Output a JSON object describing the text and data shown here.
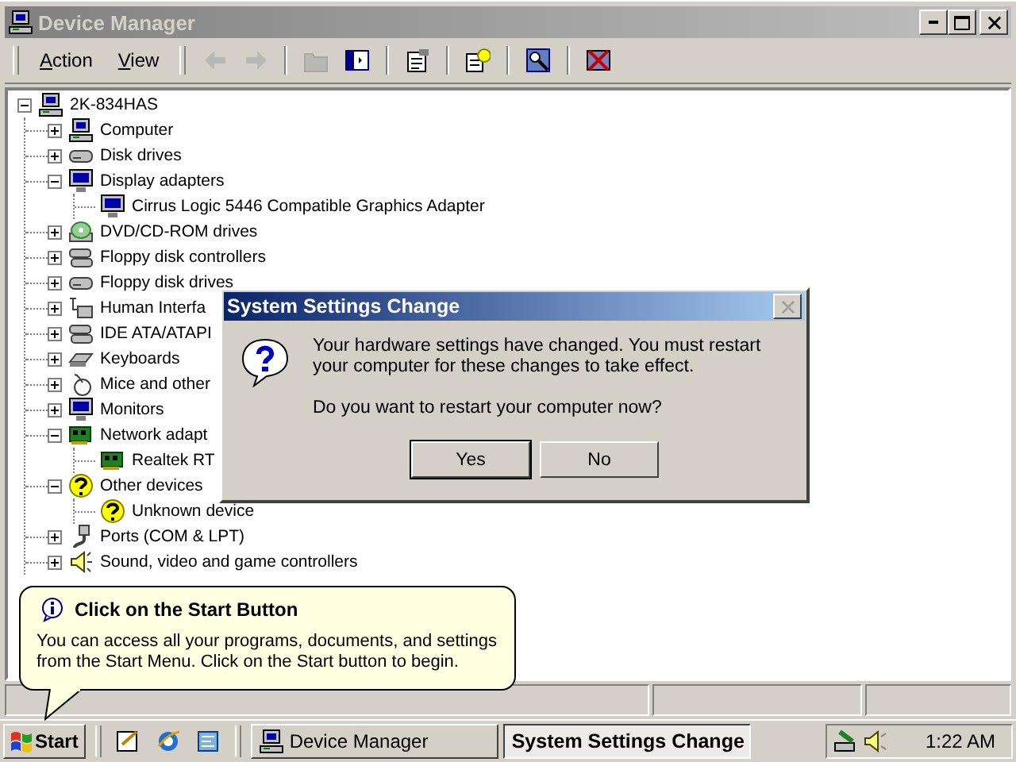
{
  "window": {
    "title": "Device Manager",
    "active": false,
    "menu": [
      {
        "label": "Action"
      },
      {
        "label": "View"
      }
    ],
    "toolbar": [
      {
        "kind": "back",
        "disabled": true
      },
      {
        "kind": "forward",
        "disabled": true
      },
      {
        "kind": "up",
        "disabled": true
      },
      {
        "kind": "tree",
        "disabled": false
      },
      {
        "kind": "properties",
        "disabled": false
      },
      {
        "kind": "help",
        "disabled": false
      },
      {
        "kind": "scan",
        "disabled": false
      },
      {
        "kind": "uninstall",
        "disabled": false
      }
    ]
  },
  "tree": {
    "label": "2K-834HAS",
    "kind": "computer",
    "expanded": true,
    "children": [
      {
        "label": "Computer",
        "kind": "computer",
        "expanded": false
      },
      {
        "label": "Disk drives",
        "kind": "disk",
        "expanded": false
      },
      {
        "label": "Display adapters",
        "kind": "monitor",
        "expanded": true,
        "children": [
          {
            "label": "Cirrus Logic 5446 Compatible Graphics Adapter",
            "kind": "monitor"
          }
        ]
      },
      {
        "label": "DVD/CD-ROM drives",
        "kind": "cdrom",
        "expanded": false
      },
      {
        "label": "Floppy disk controllers",
        "kind": "ide",
        "expanded": false
      },
      {
        "label": "Floppy disk drives",
        "kind": "disk",
        "expanded": false
      },
      {
        "label": "Human Interfa",
        "kind": "hid",
        "expanded": false
      },
      {
        "label": "IDE ATA/ATAPI",
        "kind": "ide",
        "expanded": false
      },
      {
        "label": "Keyboards",
        "kind": "keyboard",
        "expanded": false
      },
      {
        "label": "Mice and other",
        "kind": "mouse",
        "expanded": false
      },
      {
        "label": "Monitors",
        "kind": "monitor",
        "expanded": false
      },
      {
        "label": "Network adapt",
        "kind": "network",
        "expanded": true,
        "children": [
          {
            "label": "Realtek RT",
            "kind": "network"
          }
        ]
      },
      {
        "label": "Other devices",
        "kind": "question",
        "expanded": true,
        "children": [
          {
            "label": "Unknown device",
            "kind": "question"
          }
        ]
      },
      {
        "label": "Ports (COM & LPT)",
        "kind": "port",
        "expanded": false
      },
      {
        "label": "Sound, video and game controllers",
        "kind": "sound",
        "expanded": false
      }
    ]
  },
  "dialog": {
    "title": "System Settings Change",
    "close_disabled": true,
    "message": "Your hardware settings have changed. You must restart your computer for these changes to take effect.",
    "question": "Do you want to restart your computer now?",
    "buttons": [
      {
        "label": "Yes",
        "default": true
      },
      {
        "label": "No",
        "default": false
      }
    ]
  },
  "balloon": {
    "title": "Click on the Start Button",
    "text": "You can access all your programs, documents, and settings from the Start Menu. Click on the Start button to begin."
  },
  "taskbar": {
    "start": "Start",
    "quick_launch": [
      {
        "kind": "desktop"
      },
      {
        "kind": "browser"
      },
      {
        "kind": "channels"
      }
    ],
    "tasks": [
      {
        "label": "Device Manager",
        "selected": false
      },
      {
        "label": "System Settings Change",
        "selected": true
      }
    ],
    "clock": "1:22 AM"
  }
}
